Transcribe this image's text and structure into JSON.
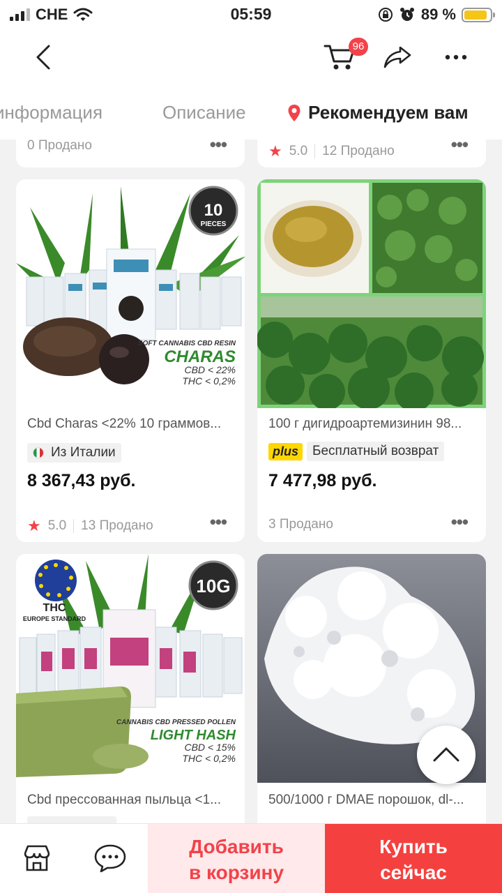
{
  "status": {
    "carrier": "CHE",
    "time": "05:59",
    "battery": "89 %",
    "battery_level": 0.89
  },
  "header": {
    "cart_badge": "96"
  },
  "tabs": [
    {
      "label": "информация"
    },
    {
      "label": "Описание"
    },
    {
      "label": "Рекомендуем вам"
    }
  ],
  "top_cards": [
    {
      "sold": "0 Продано"
    },
    {
      "rating": "5.0",
      "sold": "12 Продано"
    }
  ],
  "products": [
    {
      "title": "Cbd Charas <22% 10 граммов...",
      "tag": "Из Италии",
      "price": "8 367,43 руб.",
      "rating": "5.0",
      "sold": "13 Продано",
      "image_text": {
        "badge_top": "10",
        "badge_bottom": "PIECES",
        "line1": "SOFT CANNABIS CBD RESIN",
        "line2": "CHARAS",
        "line3": "CBD < 22%",
        "line4": "THC < 0,2%"
      }
    },
    {
      "title": "100 г дигидроартемизинин 98...",
      "plus": "plus",
      "tag": "Бесплатный возврат",
      "price": "7 477,98 руб.",
      "sold": "3 Продано"
    },
    {
      "title": "Cbd прессованная пыльца <1...",
      "image_text": {
        "badge": "10G",
        "eu": "THC",
        "eu_sub": "EUROPE STANDARD",
        "line1": "CANNABIS CBD PRESSED POLLEN",
        "line2": "LIGHT HASH",
        "line3": "CBD < 15%",
        "line4": "THC < 0,2%"
      }
    },
    {
      "title": "500/1000 г DMAE порошок, dl-..."
    }
  ],
  "bottom": {
    "add_to_cart": "Добавить\nв корзину",
    "buy_now": "Купить\nсейчас"
  },
  "colors": {
    "accent": "#f2424a",
    "buy": "#f4413f",
    "cart_bg": "#ffe9ea",
    "plus": "#ffd600"
  }
}
